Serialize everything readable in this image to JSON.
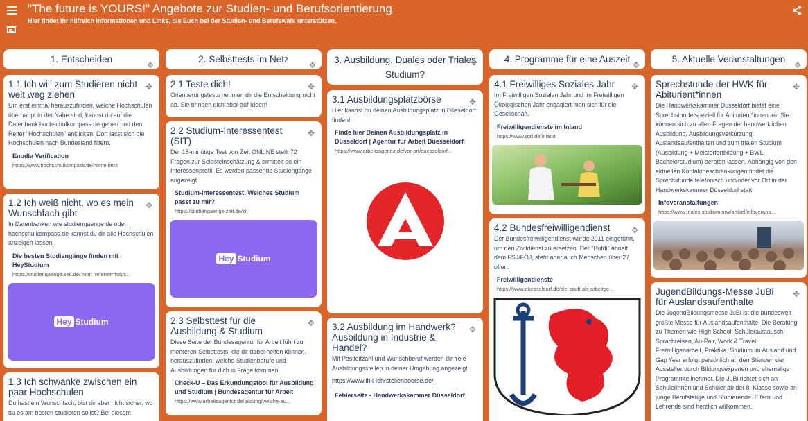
{
  "header": {
    "title": "\"The future is YOURS!\" Angebote zur Studien- und Berufsorientierung",
    "subtitle": "Hier findet Ihr hilfreich Informationen und Links, die Euch bei der Studien- und Berufswahl unterstützen.",
    "background": "#d9652b"
  },
  "icons": {
    "menu": "hamburger-menu-icon",
    "wall": "wall-info-icon",
    "share": "share-icon",
    "move": "move-icon"
  },
  "columns": [
    {
      "title": "1. Entscheiden",
      "cards": [
        {
          "title": "1.1 Ich will zum Studieren nicht weit weg ziehen",
          "body": "Um erst einmal herauszufinden, welche Hochschulen überhaupt in der Nähe sind, kannst du auf die Datenbank hochschulkompass.de gehen und den Reiter \"Hochschulen\" anklicken. Dort lasst sich die Hochschulen nach Bundesland filtern.",
          "link_title": "Enodia Verification",
          "link_url": "https://www.hochschulkompass.de/home.html"
        },
        {
          "title": "1.2 Ich weiß nicht, wo es mein Wunschfach gibt",
          "body": "In Datenbanken wie studiengaenge.de oder hochschulkompass.de kannst du dir alle Hochschulen anzeigen lassen.",
          "link_title": "Die besten Studiengänge finden mit HeyStudium",
          "link_url": "https://studiengaenge.zeit.de/?utm_referrer=https...",
          "image_label_pill": "Hey",
          "image_label_text": "Studium"
        },
        {
          "title": "1.3 Ich schwanke zwischen ein paar Hochschulen",
          "body": "Du hast ein Wunschfach, bist dir aber nicht sicher, wo du es am besten studieren sollst? Bei diesem"
        }
      ]
    },
    {
      "title": "2. Selbsttests im Netz",
      "cards": [
        {
          "title": "2.1 Teste dich!",
          "body": "Orientierungstests nehmen dir die Entscheidung nicht ab. Sie bringen dich aber auf Ideen!"
        },
        {
          "title": "2.2 Studium-Interessentest (SIT)",
          "body": "Der 15-minütige Test von Zeit ONLINE stellt 72 Fragen zur Selbsteinschätzung & ermittelt so ein Interessenprofil. Es werden passende Studiengänge angezeigt",
          "link_title": "Studium-Interessentest: Welches Studium passt zu mir?",
          "link_url": "https://studiengaenge.zeit.de/sit",
          "image_label_pill": "Hey",
          "image_label_text": "Studium"
        },
        {
          "title": "2.3 Selbsttest für die Ausbildung & Studium",
          "body": "Diese Seite der Bundesagentur für Arbeit führt zu mehreren Selbsttests, die dir dabei helfen können, herauszufinden, welche Studienberufe und Ausbildungen für dich in Frage kommen",
          "link_title": "Check-U – Das Erkundungstool für Ausbildung und Studium | Bundesagentur für Arbeit",
          "link_url": "https://www.arbeitsagentur.de/bildung/welche-au..."
        }
      ]
    },
    {
      "title": "3. Ausbildung, Duales oder Triales Studium?",
      "cards": [
        {
          "title": "3.1 Ausbildungsplatzbörse",
          "body": "Hier kannst du deinen Ausbildungsplatz in Düsseldorf finden!",
          "link_title": "Finde hier Deinen Ausbildungsplatz in Düsseldorf | Agentur für Arbeit Duesseldorf",
          "link_url": "https://www.arbeitsagentur.de/vor-ort/duesseldorf..."
        },
        {
          "title": "3.2 Ausbildung im Handwerk? Ausbildung in Industrie & Handel?",
          "body": "Mit Postleitzahl und Wunschberuf werden dir freie Ausbildungsstellen in deiner Umgebung angezeigt.",
          "plain_link": "https://www.ihk-lehrstellenboerse.de/",
          "link_title": "Fehlerseite - Handwerkskammer Düsseldorf"
        }
      ]
    },
    {
      "title": "4. Programme für eine Auszeit",
      "cards": [
        {
          "title": "4.1 Freiwilliges Soziales Jahr",
          "body": "Im Freiwilligen Sozialen Jahr und im Freiwilligen Ökologischen Jahr engagiert man sich für die Gesellschaft.",
          "link_title": "Freiwilligendienste im Inland",
          "link_url": "https://www.ijgd.de/inland"
        },
        {
          "title": "4.2 Bundesfreiwilligendienst",
          "body": "Der Bundesfreiwilligendienst wurde 2011 eingeführt, um den Zivildienst zu ersetzen. Der \"Bufdi\" ähnelt dem FSJ/FÖJ, steht aber auch Menschen über 27 offen.",
          "link_title": "Freiwilligendienste",
          "link_url": "https://www.duesseldorf.de/die-stadt-als-arbeitge..."
        }
      ]
    },
    {
      "title": "5. Aktuelle Veranstaltungen",
      "cards": [
        {
          "title": "Sprechstunde der HWK für Abiturient*innen",
          "body": " Die Handwerkskammer Düsseldorf bietet eine Sprechstunde speziell für Abiturient*innen an. Sie können sich zu allen Fragen der handwerklichen Ausbildung, Ausbildungsverkürzung, Auslandsaufenthalten und zum trialen Studium (Ausbildung + Meisterfortbildung + BWL-Bachelorstudium) beraten lassen. Abhängig von den aktuellen Kontaktbeschränkungen findet die Sprechstunde telefonisch und/oder vor Ort in der Handwerkskammer Düsseldorf statt.",
          "link_title": "Infoveranstaltungen",
          "link_url": "https://www.triales-studium.nrw/artikel/infoverans..."
        },
        {
          "title": "JugendBildungs-Messe JuBi für Auslandsaufenthalte",
          "body": "Die JugendBildungsmesse JuBi ist die bundesweit größte Messe für Auslandsaufenthalte. Die Beratung zu Themen wie High School, Schüleraustausch, Sprachreisen, Au-Pair, Work & Travel, Freiwilligenarbeit, Praktika, Studium im Ausland und Gap Year erfolgt persönlich an den Ständen der Aussteller durch Bildungsexperten und ehemalige Programmteilnehmer. Die JuBi richtet sich an Schülerinnen und Schüler ab der 8. Klasse sowie an junge Berufstätige und Studierende. Eltern und Lehrende sind herzlich willkommen."
        }
      ]
    }
  ]
}
